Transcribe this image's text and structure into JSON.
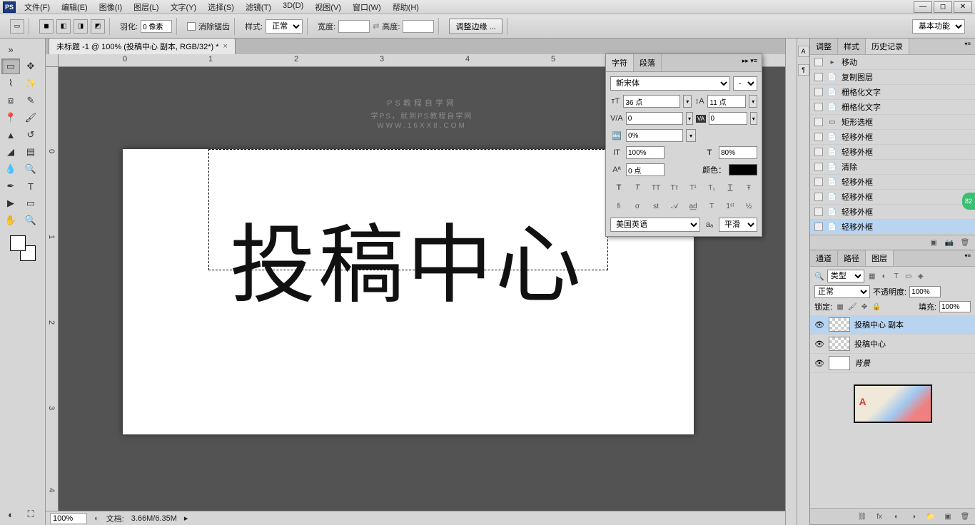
{
  "menu": [
    "文件(F)",
    "编辑(E)",
    "图像(I)",
    "图层(L)",
    "文字(Y)",
    "选择(S)",
    "滤镜(T)",
    "3D(D)",
    "视图(V)",
    "窗口(W)",
    "帮助(H)"
  ],
  "optbar": {
    "feather_label": "羽化:",
    "feather_value": "0 像素",
    "antialias_label": "消除锯齿",
    "style_label": "样式:",
    "style_value": "正常",
    "width_label": "宽度:",
    "width_value": "",
    "height_label": "高度:",
    "height_value": "",
    "refine_label": "调整边缘 ...",
    "workspace": "基本功能"
  },
  "doc_tab": "未标题 -1 @ 100% (投稿中心 副本, RGB/32*) *",
  "watermark": {
    "title": "PS教程自学网",
    "sub": "学PS，就到PS教程自学网",
    "url": "WWW.16XX8.COM"
  },
  "canvas_text": "投稿中心",
  "status": {
    "zoom": "100%",
    "doc_label": "文档:",
    "doc_value": "3.66M/6.35M"
  },
  "char_panel": {
    "tabs": [
      "字符",
      "段落"
    ],
    "font": "新宋体",
    "style": "-",
    "size": "36 点",
    "leading": "11 点",
    "va": "0",
    "tracking": "0",
    "scale": "0%",
    "hscale": "100%",
    "vscale": "80%",
    "baseline": "0 点",
    "color_label": "颜色：",
    "lang": "美国英语",
    "aa": "平滑"
  },
  "history": {
    "tabs": [
      "调整",
      "样式",
      "历史记录"
    ],
    "items": [
      {
        "icon": "▸",
        "label": "移动"
      },
      {
        "icon": "📄",
        "label": "复制图层"
      },
      {
        "icon": "📄",
        "label": "栅格化文字"
      },
      {
        "icon": "📄",
        "label": "栅格化文字"
      },
      {
        "icon": "▭",
        "label": "矩形选框"
      },
      {
        "icon": "📄",
        "label": "轻移外框"
      },
      {
        "icon": "📄",
        "label": "轻移外框"
      },
      {
        "icon": "📄",
        "label": "清除"
      },
      {
        "icon": "📄",
        "label": "轻移外框"
      },
      {
        "icon": "📄",
        "label": "轻移外框"
      },
      {
        "icon": "📄",
        "label": "轻移外框"
      },
      {
        "icon": "📄",
        "label": "轻移外框"
      }
    ]
  },
  "layers_panel": {
    "tabs": [
      "通道",
      "路径",
      "图层"
    ],
    "kind_label": "类型",
    "blend": "正常",
    "opacity_label": "不透明度:",
    "opacity": "100%",
    "lock_label": "锁定:",
    "fill_label": "填充:",
    "fill": "100%",
    "layers": [
      {
        "name": "投稿中心 副本",
        "selected": true,
        "thumb": "checker"
      },
      {
        "name": "投稿中心",
        "selected": false,
        "thumb": "checker"
      },
      {
        "name": "背景",
        "selected": false,
        "thumb": "white",
        "italic": true
      }
    ]
  },
  "badge": "82"
}
